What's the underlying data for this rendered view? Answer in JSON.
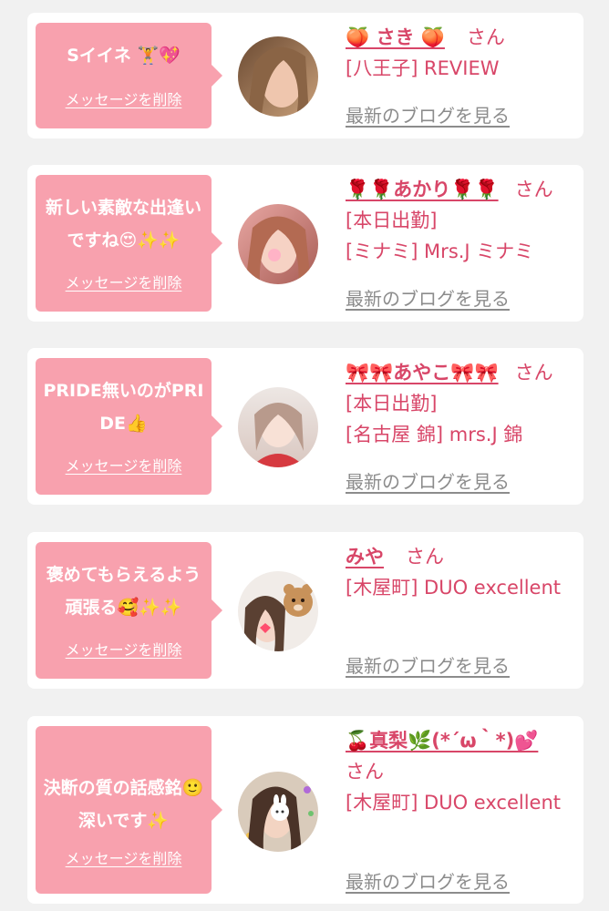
{
  "accent_color": "#d84668",
  "bubble_color": "#f8a1ae",
  "cards": [
    {
      "message": "Sイイネ 🏋️💖",
      "delete_label": "メッセージを削除",
      "name": "🍑 さき 🍑",
      "honorific": "さん",
      "shop": "[八王子] REVIEW",
      "blog_label": "最新のブログを見る"
    },
    {
      "message": "新しい素敵な出逢いですね😍✨✨",
      "delete_label": "メッセージを削除",
      "name": "🌹🌹あかり🌹🌹",
      "honorific": "さん[本日出勤]",
      "shop": "[ミナミ] Mrs.J ミナミ",
      "blog_label": "最新のブログを見る"
    },
    {
      "message": "PRIDE無いのがPRIDE👍",
      "delete_label": "メッセージを削除",
      "name": "🎀🎀あやこ🎀🎀",
      "honorific": "さん[本日出勤]",
      "shop": "[名古屋 錦] mrs.J 錦",
      "blog_label": "最新のブログを見る"
    },
    {
      "message": "褒めてもらえるよう頑張る🥰✨✨",
      "delete_label": "メッセージを削除",
      "name": "みや",
      "honorific": "さん",
      "shop": "[木屋町] DUO excellent",
      "blog_label": "最新のブログを見る"
    },
    {
      "message": "決断の質の話感銘🙂深いです✨",
      "delete_label": "メッセージを削除",
      "name": "🍒真梨🌿(*´ω｀*)💕",
      "honorific": "さん",
      "shop": "[木屋町] DUO excellent",
      "blog_label": "最新のブログを見る"
    }
  ]
}
